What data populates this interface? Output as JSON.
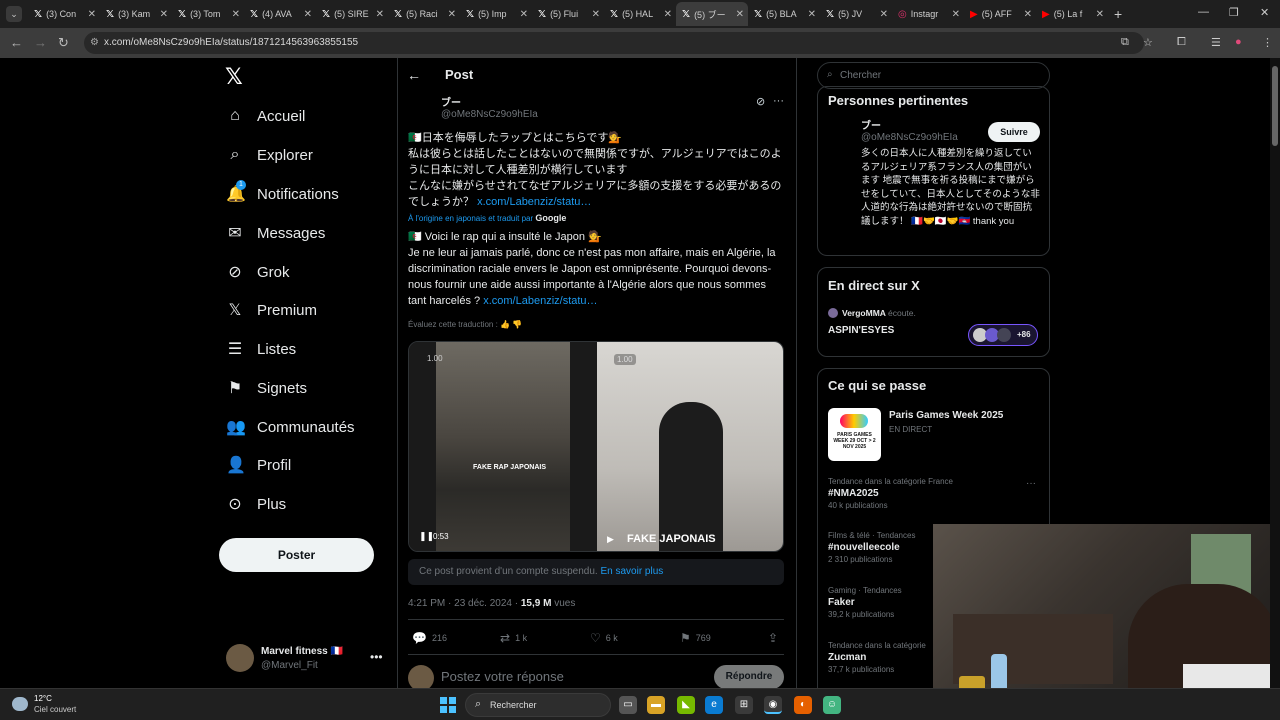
{
  "browser": {
    "tabs": [
      {
        "label": "(3) Con",
        "icon": "x-icon"
      },
      {
        "label": "(3) Kam",
        "icon": "x-icon"
      },
      {
        "label": "(3) Tom",
        "icon": "x-icon"
      },
      {
        "label": "(4) AVA",
        "icon": "x-icon"
      },
      {
        "label": "(5) SIRE",
        "icon": "x-icon"
      },
      {
        "label": "(5) Raci",
        "icon": "x-icon"
      },
      {
        "label": "(5) Imp",
        "icon": "x-icon"
      },
      {
        "label": "(5) Flui",
        "icon": "x-icon"
      },
      {
        "label": "(5) HAL",
        "icon": "x-icon"
      },
      {
        "label": "(5) ブー",
        "icon": "x-icon"
      },
      {
        "label": "(5) BLA",
        "icon": "x-icon"
      },
      {
        "label": "(5) JV",
        "icon": "x-icon"
      },
      {
        "label": "Instagr",
        "icon": "instagram-icon"
      },
      {
        "label": "(5) AFF",
        "icon": "youtube-icon"
      },
      {
        "label": "(5) La f",
        "icon": "youtube-icon"
      }
    ],
    "url": "x.com/oMe8NsCz9o9hEIa/status/1871214563963855155"
  },
  "nav": {
    "logo": "𝕏",
    "items": [
      {
        "label": "Accueil",
        "icon": "⌂"
      },
      {
        "label": "Explorer",
        "icon": "⌕"
      },
      {
        "label": "Notifications",
        "icon": "🔔",
        "badge": "1"
      },
      {
        "label": "Messages",
        "icon": "✉"
      },
      {
        "label": "Grok",
        "icon": "⊘"
      },
      {
        "label": "Premium",
        "icon": "𝕏"
      },
      {
        "label": "Listes",
        "icon": "☰"
      },
      {
        "label": "Signets",
        "icon": "⚑"
      },
      {
        "label": "Communautés",
        "icon": "👥"
      },
      {
        "label": "Profil",
        "icon": "👤"
      },
      {
        "label": "Plus",
        "icon": "⊙"
      }
    ],
    "post_button": "Poster",
    "account": {
      "name": "Marvel fitness 🇫🇷",
      "handle": "@Marvel_Fit"
    }
  },
  "post": {
    "header_title": "Post",
    "author_name": "ブー",
    "author_handle": "@oMe8NsCz9o9hEIa",
    "original_text_1": "🇩🇿日本を侮辱したラップとはこちらです💁",
    "original_text_2": "私は彼らとは話したことはないので無関係ですが、アルジェリアではこのように日本に対して人種差別が横行しています",
    "original_text_3": "こんなに嫌がらせされてなぜアルジェリアに多額の支援をする必要があるのでしょうか？",
    "original_link": "x.com/Labenziz/statu…",
    "translated_by": "À l'origine en japonais et traduit par",
    "translated_brand": "Google",
    "translated_text_1": "🇩🇿 Voici le rap qui a insulté le Japon 💁",
    "translated_text_2": "Je ne leur ai jamais parlé, donc ce n'est pas mon affaire, mais en Algérie, la discrimination raciale envers le Japon est omniprésente. Pourquoi devons-nous fournir une aide aussi importante à l'Algérie alors que nous sommes tant harcelés ?",
    "translated_link": "x.com/Labenziz/statu…",
    "rate_translation": "Évaluez cette traduction :",
    "media": {
      "left_caption": "FAKE RAP JAPONAIS",
      "right_caption": "FAKE JAPONAIS",
      "time": "0:53",
      "speed_left": "1.00",
      "speed_right": "1.00"
    },
    "suspended_note": "Ce post provient d'un compte suspendu.",
    "suspended_link": "En savoir plus",
    "timestamp": "4:21 PM · 23 déc. 2024 ·",
    "views_count": "15,9 M",
    "views_label": "vues",
    "actions": {
      "replies": "216",
      "reposts": "1 k",
      "likes": "6 k",
      "bookmarks": "769"
    },
    "reply_placeholder": "Postez votre réponse",
    "reply_button": "Répondre"
  },
  "sidebar": {
    "search_placeholder": "Chercher",
    "relevant_title": "Personnes pertinentes",
    "relevant": {
      "name": "ブー",
      "handle": "@oMe8NsCz9o9hEIa",
      "follow": "Suivre",
      "bio": "多くの日本人に人種差別を繰り返しているアルジェリア系フランス人の集団がいます 地震で無事を祈る投稿にまで嫌がらせをしていて、日本人としてそのような非人道的な行為は絶対許せないので断固抗議します！ 🇫🇷🤝🇯🇵🤝🇰🇭 thank you"
    },
    "live_title": "En direct sur X",
    "live": {
      "host": "VergoMMA",
      "host_action": "écoute.",
      "title": "ASPIN'ESYES",
      "count": "+86"
    },
    "happening_title": "Ce qui se passe",
    "event": {
      "title": "Paris Games Week 2025",
      "status": "EN DIRECT",
      "img_text": "PARIS GAMES WEEK 29 OCT > 2 NOV 2025"
    },
    "trends": [
      {
        "context": "Tendance dans la catégorie France",
        "name": "#NMA2025",
        "posts": "40 k publications"
      },
      {
        "context": "Films & télé · Tendances",
        "name": "#nouvelleecole",
        "posts": "2 310 publications"
      },
      {
        "context": "Gaming · Tendances",
        "name": "Faker",
        "posts": "39,2 k publications"
      },
      {
        "context": "Tendance dans la catégorie",
        "name": "Zucman",
        "posts": "37,7 k publications"
      }
    ]
  },
  "taskbar": {
    "temp": "12°C",
    "weather": "Ciel couvert",
    "search": "Rechercher"
  }
}
